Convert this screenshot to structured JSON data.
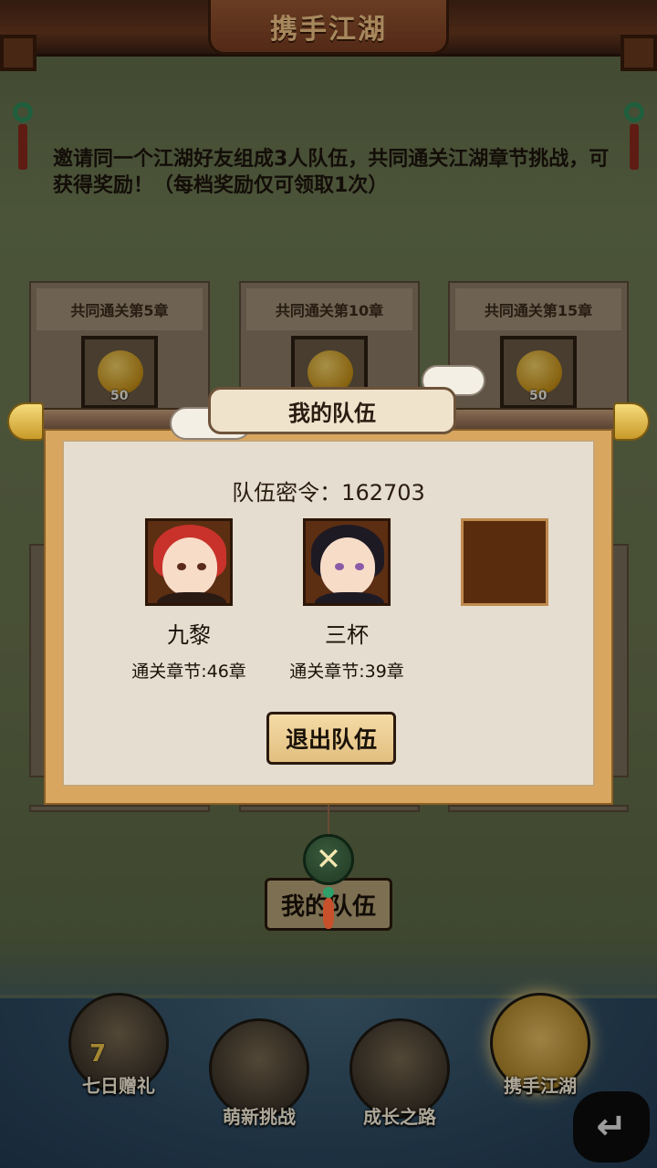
{
  "header": {
    "title": "携手江湖"
  },
  "intro": "邀请同一个江湖好友组成3人队伍，共同通关江湖章节挑战，可获得奖励！（每档奖励仅可领取1次）",
  "rewards": [
    {
      "label": "共同通关第5章",
      "qty": "50",
      "icon": "golden-gourd-icon"
    },
    {
      "label": "共同通关第10章",
      "qty": "50",
      "icon": "golden-gourd-icon"
    },
    {
      "label": "共同通关第15章",
      "qty": "50",
      "icon": "golden-gourd-icon"
    }
  ],
  "background_button": {
    "label": "我的队伍"
  },
  "modal": {
    "title": "我的队伍",
    "team_code": "队伍密令：162703",
    "members": [
      {
        "name": "九黎",
        "chapter": "通关章节:46章",
        "hair_color": "#c8322a"
      },
      {
        "name": "三杯",
        "chapter": "通关章节:39章",
        "hair_color": "#1e1a24"
      }
    ],
    "empty_slots": 1,
    "leave_button": "退出队伍",
    "close_icon": "crossed-swords-close-icon"
  },
  "bottom_nav": [
    {
      "label": "七日赠礼",
      "icon": "seven-day-gift-icon",
      "badge": "7",
      "active": false
    },
    {
      "label": "萌新挑战",
      "icon": "newbie-challenge-icon",
      "active": false
    },
    {
      "label": "成长之路",
      "icon": "growth-path-icon",
      "active": false
    },
    {
      "label": "携手江湖",
      "icon": "handshake-icon",
      "active": true
    }
  ],
  "back_button": {
    "icon": "return-arrow-icon",
    "glyph": "↵"
  }
}
